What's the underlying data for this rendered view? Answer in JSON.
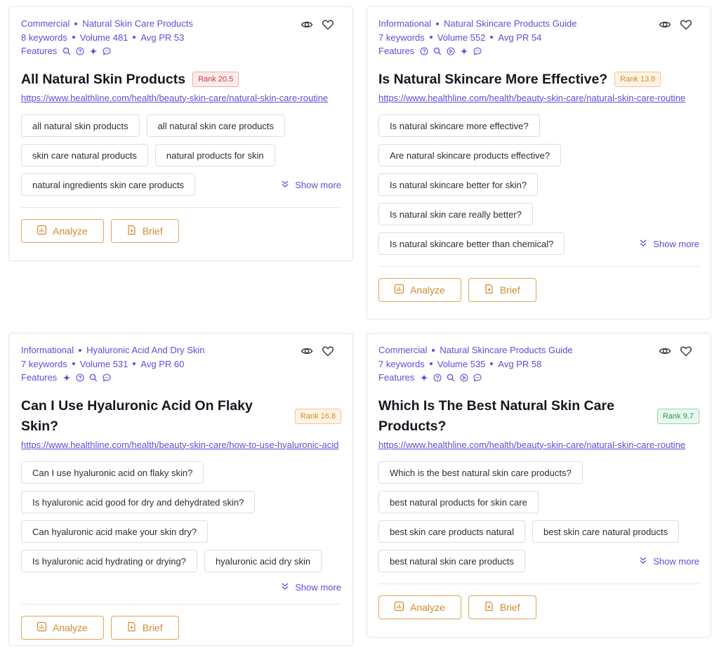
{
  "cards": [
    {
      "intent": "Commercial",
      "topic": "Natural Skin Care Products",
      "keywords": "8 keywords",
      "volume": "Volume 481",
      "avg_pr": "Avg PR 53",
      "features_label": "Features",
      "features": [
        "search-icon",
        "question-icon",
        "sparkle-icon",
        "chat-icon"
      ],
      "title": "All Natural Skin Products",
      "rank": "Rank 20.5",
      "rank_color": "#d43a3a",
      "url": "https://www.healthline.com/health/beauty-skin-care/natural-skin-care-routine",
      "chips": [
        "all natural skin products",
        "all natural skin care products",
        "skin care natural products",
        "natural products for skin",
        "natural ingredients skin care products"
      ],
      "show_more": "Show more",
      "analyze": "Analyze",
      "brief": "Brief"
    },
    {
      "intent": "Informational",
      "topic": "Natural Skincare Products Guide",
      "keywords": "7 keywords",
      "volume": "Volume 552",
      "avg_pr": "Avg PR 54",
      "features_label": "Features",
      "features": [
        "question-icon",
        "search-icon",
        "play-icon",
        "sparkle-icon",
        "chat-icon"
      ],
      "title": "Is Natural Skincare More Effective?",
      "rank": "Rank 13.8",
      "rank_color": "#d98a22",
      "url": "https://www.healthline.com/health/beauty-skin-care/natural-skin-care-routine",
      "chips": [
        "Is natural skincare more effective?",
        "Are natural skincare products effective?",
        "Is natural skincare better for skin?",
        "Is natural skin care really better?",
        "Is natural skincare better than chemical?"
      ],
      "show_more": "Show more",
      "analyze": "Analyze",
      "brief": "Brief"
    },
    {
      "intent": "Informational",
      "topic": "Hyaluronic Acid And Dry Skin",
      "keywords": "7 keywords",
      "volume": "Volume 531",
      "avg_pr": "Avg PR 60",
      "features_label": "Features",
      "features": [
        "sparkle-icon",
        "question-icon",
        "search-icon",
        "chat-icon"
      ],
      "title": "Can I Use Hyaluronic Acid On Flaky Skin?",
      "rank": "Rank 16.8",
      "rank_color": "#d98a22",
      "url": "https://www.healthline.com/health/beauty-skin-care/how-to-use-hyaluronic-acid",
      "chips": [
        "Can I use hyaluronic acid on flaky skin?",
        "Is hyaluronic acid good for dry and dehydrated skin?",
        "Can hyaluronic acid make your skin dry?",
        "Is hyaluronic acid hydrating or drying?",
        "hyaluronic acid dry skin"
      ],
      "show_more": "Show more",
      "analyze": "Analyze",
      "brief": "Brief"
    },
    {
      "intent": "Commercial",
      "topic": "Natural Skincare Products Guide",
      "keywords": "7 keywords",
      "volume": "Volume 535",
      "avg_pr": "Avg PR 58",
      "features_label": "Features",
      "features": [
        "sparkle-icon",
        "question-icon",
        "search-icon",
        "play-icon",
        "chat-icon"
      ],
      "title": "Which Is The Best Natural Skin Care Products?",
      "rank": "Rank 9.7",
      "rank_color": "#26985a",
      "url": "https://www.healthline.com/health/beauty-skin-care/natural-skin-care-routine",
      "chips": [
        "Which is the best natural skin care products?",
        "best natural products for skin care",
        "best skin care products natural",
        "best skin care natural products",
        "best natural skin care products"
      ],
      "show_more": "Show more",
      "analyze": "Analyze",
      "brief": "Brief"
    }
  ]
}
